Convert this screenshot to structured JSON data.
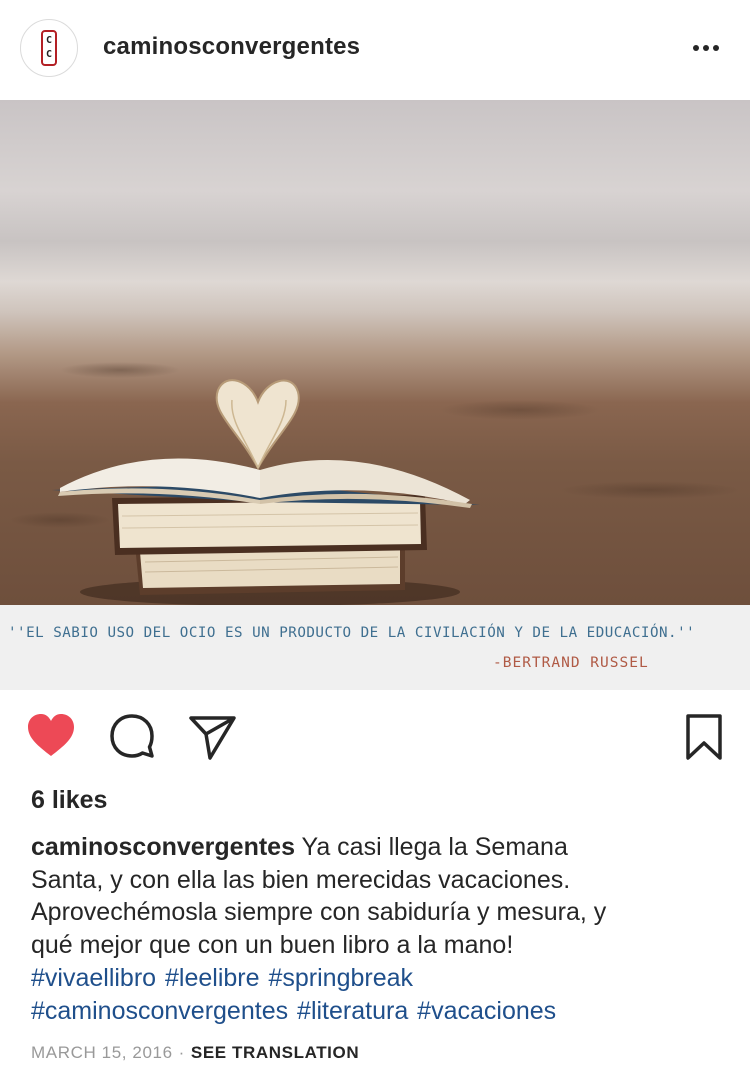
{
  "post": {
    "account": "caminosconvergentes",
    "avatar_letters": [
      "C",
      "C"
    ],
    "quote": "''EL SABIO USO DEL OCIO ES UN PRODUCTO DE LA CIVILACIÓN Y DE LA EDUCACIÓN.''",
    "quote_author": "-BERTRAND RUSSEL"
  },
  "engagement": {
    "likes": "6 likes"
  },
  "caption": {
    "user": "caminosconvergentes",
    "lines": [
      " Ya casi llega la Semana",
      "Santa, y con ella las bien merecidas vacaciones.",
      "Aprovechémosla siempre con sabiduría y mesura, y",
      "qué mejor que con un buen libro a la mano!"
    ],
    "hashtags_line1": [
      "#vivaellibro",
      "#leelibre",
      "#springbreak"
    ],
    "hashtags_line2": [
      "#caminosconvergentes",
      "#literatura",
      "#vacaciones"
    ]
  },
  "meta": {
    "date": "MARCH 15, 2016",
    "separator": "·",
    "translate_label": "SEE TRANSLATION"
  },
  "icons": {
    "like": "heart-icon",
    "comment": "comment-icon",
    "share": "send-icon",
    "save": "bookmark-icon",
    "more": "more-icon"
  },
  "colors": {
    "like_active": "#ed4956",
    "hashtag": "#1f4f8b",
    "quote_text": "#3f6f90",
    "quote_author": "#b05a45"
  }
}
